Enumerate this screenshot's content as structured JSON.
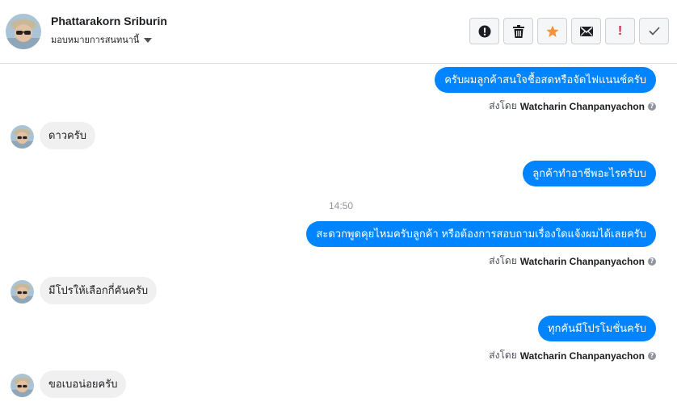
{
  "header": {
    "name": "Phattarakorn Sriburin",
    "assign_label": "มอบหมายการสนทนานี้"
  },
  "toolbar": {
    "buttons": [
      "info-icon",
      "trash-icon",
      "star-icon",
      "envelope-icon",
      "spam-icon",
      "check-icon"
    ],
    "accent_star": "#f7923b",
    "spam_color": "#e41e3f"
  },
  "colors": {
    "outgoing_bubble": "#0084ff",
    "incoming_bubble": "#f1f0f0"
  },
  "messages": [
    {
      "dir": "out",
      "text": "ครับผมลูกค้าสนใจชื้อสดหรือจัดไฟแนนช์ครับ",
      "sent_prefix": "ส่งโดย",
      "sender": "Watcharin Chanpanyachon"
    },
    {
      "dir": "in",
      "text": "ดาวครับ"
    },
    {
      "dir": "out",
      "text": "ลูกค้าทำอาชีพอะไรครับบ"
    },
    {
      "dir": "out",
      "text": "สะดวกพูดคุยไหมครับลูกค้า หรือต้องการสอบถามเรื่องใดแจ้งผมได้เลยครับ",
      "sent_prefix": "ส่งโดย",
      "sender": "Watcharin Chanpanyachon"
    },
    {
      "dir": "in",
      "text": "มีโปรให้เลือกกี่คันครับ"
    },
    {
      "dir": "out",
      "text": "ทุกคันมีโปรโมชั่นครับ",
      "sent_prefix": "ส่งโดย",
      "sender": "Watcharin Chanpanyachon"
    },
    {
      "dir": "in",
      "text": "ขอเบอน่อยครับ"
    }
  ],
  "timestamp": "14:50"
}
